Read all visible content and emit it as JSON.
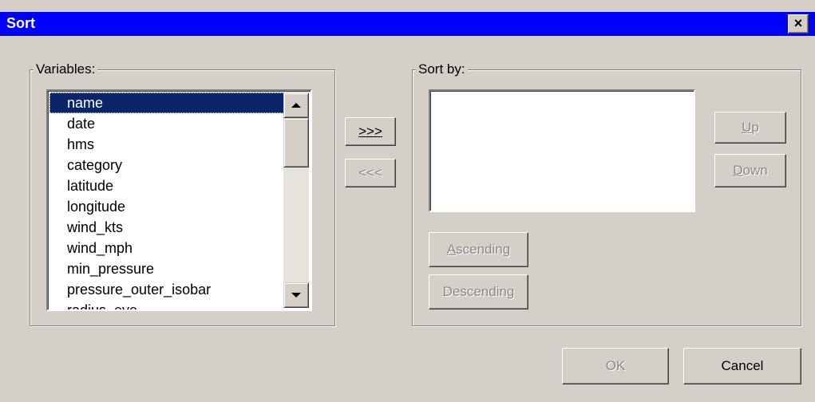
{
  "window": {
    "title": "Sort",
    "close_label": "×"
  },
  "variables": {
    "label": "Variables:",
    "items": [
      "name",
      "date",
      "hms",
      "category",
      "latitude",
      "longitude",
      "wind_kts",
      "wind_mph",
      "min_pressure",
      "pressure_outer_isobar",
      "radius_eye"
    ],
    "selected": "name"
  },
  "move": {
    "add_label": ">>>",
    "remove_label": "<<<"
  },
  "sort_by": {
    "label": "Sort by:",
    "items": []
  },
  "order": {
    "up_label": "Up",
    "down_label": "Down",
    "ascending_label": "Ascending",
    "descending_label": "Descending"
  },
  "footer": {
    "ok_label": "OK",
    "cancel_label": "Cancel"
  },
  "colors": {
    "titlebar": "#0000ff",
    "dialog_bg": "#d4d0c8",
    "selection": "#0a246a"
  }
}
